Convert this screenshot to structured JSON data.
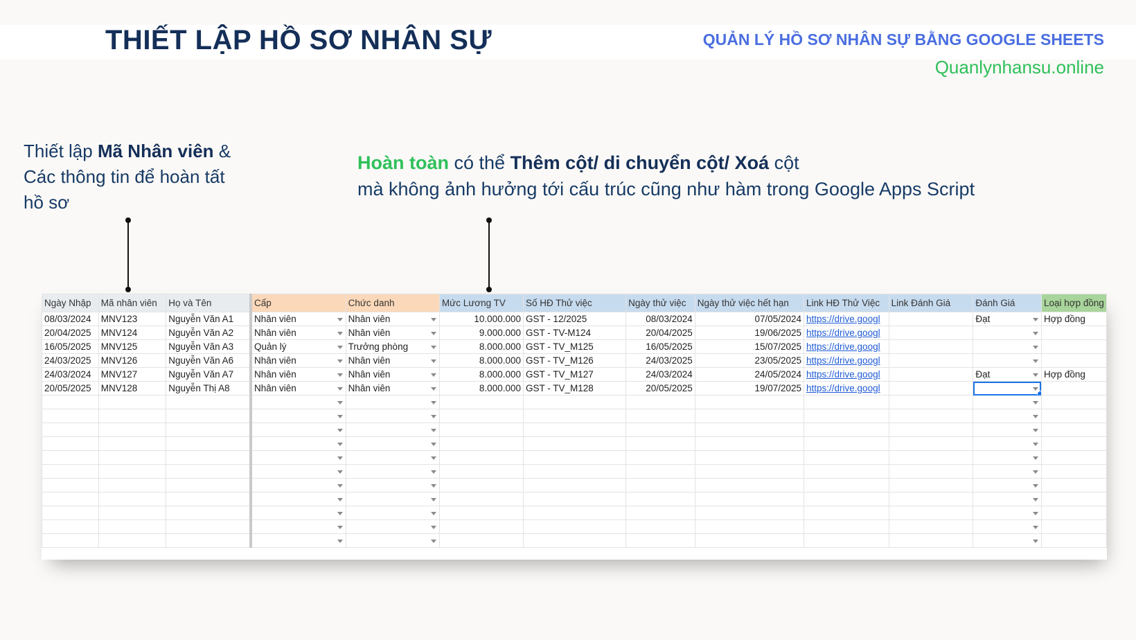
{
  "header": {
    "title": "THIẾT LẬP HỒ SƠ NHÂN SỰ",
    "subtitle": "QUẢN LÝ HỒ SƠ NHÂN SỰ BẰNG GOOGLE SHEETS",
    "website": "Quanlynhansu.online"
  },
  "notes": {
    "left": {
      "p1": "Thiết lập ",
      "b1": "Mã Nhân viên",
      "p2": " & Các thông tin để hoàn tất hồ sơ"
    },
    "right": {
      "green": "Hoàn toàn",
      "p1": " có thể ",
      "b1": "Thêm cột/ di chuyển cột/ Xoá",
      "p2": " cột",
      "line2": "mà không ảnh hưởng tới cấu trúc cũng như hàm trong Google Apps Script"
    }
  },
  "sheet": {
    "columns": [
      "Ngày Nhập",
      "Mã nhân viên",
      "Họ và Tên",
      "Cấp",
      "Chức danh",
      "Mức Lương TV",
      "Số HĐ Thử việc",
      "Ngày thử việc",
      "Ngày thử việc hết hạn",
      "Link HĐ Thử Việc",
      "Link Đánh Giá",
      "Đánh Giá",
      "Loại hợp đồng"
    ],
    "rows": [
      [
        "08/03/2024",
        "MNV123",
        "Nguyễn Văn A1",
        "Nhân viên",
        "Nhân viên",
        "10.000.000",
        "GST - 12/2025",
        "08/03/2024",
        "07/05/2024",
        "https://drive.googl",
        "",
        "Đạt",
        "Hợp đồng"
      ],
      [
        "20/04/2025",
        "MNV124",
        "Nguyễn Văn A2",
        "Nhân viên",
        "Nhân viên",
        "9.000.000",
        "GST - TV-M124",
        "20/04/2025",
        "19/06/2025",
        "https://drive.googl",
        "",
        "",
        ""
      ],
      [
        "16/05/2025",
        "MNV125",
        "Nguyễn Văn A3",
        "Quản lý",
        "Trưởng phòng",
        "8.000.000",
        "GST - TV_M125",
        "16/05/2025",
        "15/07/2025",
        "https://drive.googl",
        "",
        "",
        ""
      ],
      [
        "24/03/2025",
        "MNV126",
        "Nguyễn Văn A6",
        "Nhân viên",
        "Nhân viên",
        "8.000.000",
        "GST - TV_M126",
        "24/03/2025",
        "23/05/2025",
        "https://drive.googl",
        "",
        "",
        ""
      ],
      [
        "24/03/2024",
        "MNV127",
        "Nguyễn Văn A7",
        "Nhân viên",
        "Nhân viên",
        "8.000.000",
        "GST - TV_M127",
        "24/03/2024",
        "24/05/2024",
        "https://drive.googl",
        "",
        "Đạt",
        "Hợp đồng"
      ],
      [
        "20/05/2025",
        "MNV128",
        "Nguyễn Thị A8",
        "Nhân viên",
        "Nhân viên",
        "8.000.000",
        "GST - TV_M128",
        "20/05/2025",
        "19/07/2025",
        "https://drive.googl",
        "",
        "",
        ""
      ]
    ],
    "empty_rows": 11,
    "selected": {
      "row": 5,
      "col": 11
    },
    "header_colors": {
      "blue": "#c7dbef",
      "orange": "#fbd8b9",
      "green": "#a8d59b",
      "link": "#1f5bd6",
      "selection": "#1a73e8"
    }
  }
}
